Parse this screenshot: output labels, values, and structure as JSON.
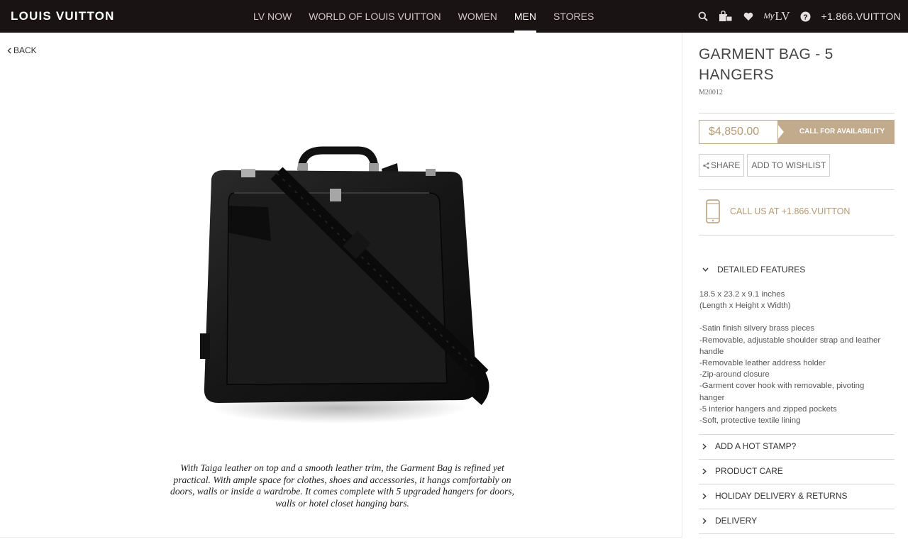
{
  "brand": "LOUIS VUITTON",
  "nav": [
    {
      "label": "LV NOW",
      "active": false
    },
    {
      "label": "WORLD OF LOUIS VUITTON",
      "active": false
    },
    {
      "label": "WOMEN",
      "active": false
    },
    {
      "label": "MEN",
      "active": true
    },
    {
      "label": "STORES",
      "active": false
    }
  ],
  "tools": {
    "icons": [
      "search-icon",
      "shopping-bag-icon",
      "heart-icon",
      "help-icon"
    ],
    "my_prefix": "My",
    "my_mark": "LV",
    "phone": "+1.866.VUITTON"
  },
  "back_label": "BACK",
  "product": {
    "title": "GARMENT BAG - 5 HANGERS",
    "sku": "M20012",
    "price": "$4,850.00",
    "availability_button": "CALL FOR AVAILABILITY",
    "share_label": "SHARE",
    "wishlist_label": "ADD TO WISHLIST",
    "call_us": "CALL US AT +1.866.VUITTON",
    "description": "With Taiga leather on top and a smooth leather trim, the Garment Bag is refined yet practical. With ample space for clothes, shoes and accessories, it hangs comfortably on doors, walls or inside a wardrobe. It comes complete with 5 upgraded hangers for doors, walls or hotel closet hanging bars."
  },
  "accordion": {
    "detailed_features": "DETAILED FEATURES",
    "dimensions": "18.5 x 23.2 x 9.1 inches",
    "dimensions_note": "(Length x Height x Width)",
    "features": [
      "-Satin finish silvery brass pieces",
      "-Removable, adjustable shoulder strap and leather handle",
      "-Removable leather address holder",
      "-Zip-around closure",
      "-Garment cover hook with removable, pivoting hanger",
      "-5 interior hangers and zipped pockets",
      "-Soft, protective textile lining"
    ],
    "sections": [
      "ADD A HOT STAMP?",
      "PRODUCT CARE",
      "HOLIDAY DELIVERY & RETURNS",
      "DELIVERY"
    ]
  },
  "colors": {
    "topbar": "#1a1313",
    "accent_gold": "#c1ab8c",
    "price_text": "#b69a72"
  }
}
